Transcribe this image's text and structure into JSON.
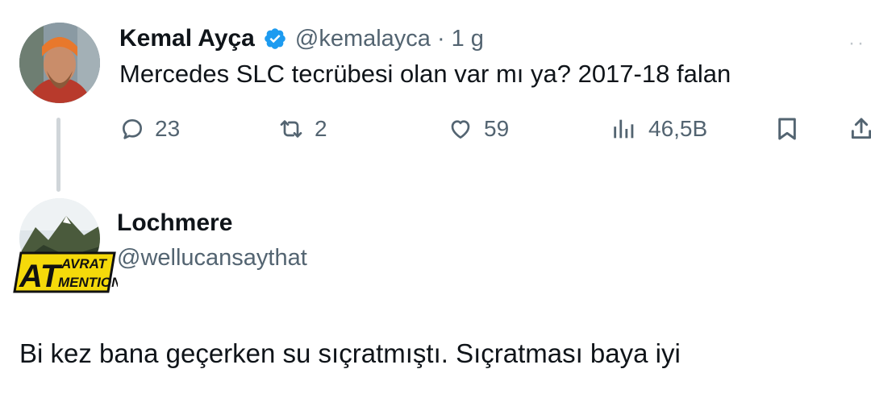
{
  "tweet": {
    "author": {
      "display_name": "Kemal Ayça",
      "handle": "@kemalayca",
      "verified": true
    },
    "separator": "·",
    "time": "1 g",
    "more": "··",
    "text": "Mercedes SLC tecrübesi olan var mı ya? 2017-18 falan",
    "stats": {
      "replies": "23",
      "retweets": "2",
      "likes": "59",
      "views": "46,5B"
    },
    "icons": [
      "reply-icon",
      "retweet-icon",
      "like-icon",
      "views-icon",
      "bookmark-icon",
      "share-icon"
    ]
  },
  "reply": {
    "author": {
      "display_name": "Lochmere",
      "handle": "@wellucansaythat"
    },
    "badge": {
      "big": "AT",
      "top": "AVRAT",
      "bottom": "MENTION"
    },
    "text": "Bi kez bana geçerken su sıçratmıştı. Sıçratması baya iyi"
  },
  "colors": {
    "text": "#0f1419",
    "secondary": "#536471",
    "verified": "#1d9bf0",
    "thread_line": "#d0d5d9",
    "badge_yellow": "#f5d90a"
  }
}
